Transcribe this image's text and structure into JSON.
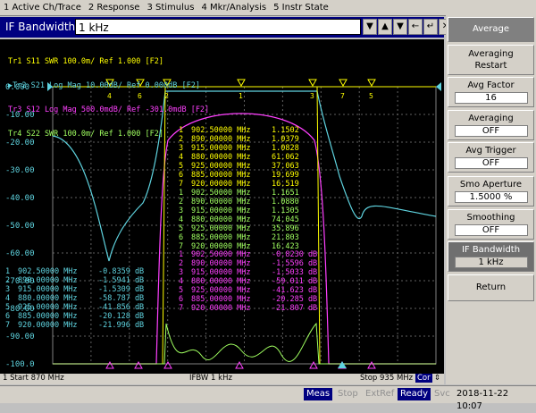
{
  "menu": [
    "1 Active Ch/Trace",
    "2 Response",
    "3 Stimulus",
    "4 Mkr/Analysis",
    "5 Instr State"
  ],
  "entry": {
    "label": "IF Bandwidth",
    "value": "1 kHz"
  },
  "traces": [
    {
      "text": "Tr1 S11 SWR 100.0m/ Ref 1.000 [F2]",
      "color": "#ffff00"
    },
    {
      "text": "▶Tr2 S21 Log Mag 10.00dB/ Ref 0.000dB [F2]",
      "color": "#5fd4e0"
    },
    {
      "text": "Tr3 S12 Log Mag 500.0mdB/ Ref -301.0mdB [F2]",
      "color": "#ff40ff"
    },
    {
      "text": "Tr4 S22 SWR 100.0m/ Ref 1.000 [F2]",
      "color": "#a0ff60"
    }
  ],
  "colors": {
    "tr1": "#ffff00",
    "tr2": "#5fd4e0",
    "tr3": "#ff40ff",
    "tr4": "#a0ff60",
    "grid": "#606060"
  },
  "y_axis": [
    "0.000",
    "-10.00",
    "-20.00",
    "-30.00",
    "-40.00",
    "-50.00",
    "-60.00",
    "-70.00",
    "-80.00",
    "-90.00",
    "-100.0"
  ],
  "markers_tr1": [
    [
      "1",
      "902.50000 MHz",
      "1.1502"
    ],
    [
      "2",
      "890.00000 MHz",
      "1.0379"
    ],
    [
      "3",
      "915.00000 MHz",
      "1.0828"
    ],
    [
      "4",
      "880.00000 MHz",
      "61.062"
    ],
    [
      "5",
      "925.00000 MHz",
      "37.063"
    ],
    [
      "6",
      "885.00000 MHz",
      "19.699"
    ],
    [
      "7",
      "920.00000 MHz",
      "16.519"
    ]
  ],
  "markers_tr4": [
    [
      "1",
      "902.50000 MHz",
      "1.1651"
    ],
    [
      "2",
      "890.00000 MHz",
      "1.0880"
    ],
    [
      "3",
      "915.00000 MHz",
      "1.1305"
    ],
    [
      "4",
      "880.00000 MHz",
      "74.045"
    ],
    [
      "5",
      "925.00000 MHz",
      "35.896"
    ],
    [
      "6",
      "885.00000 MHz",
      "21.803"
    ],
    [
      "7",
      "920.00000 MHz",
      "16.423"
    ]
  ],
  "markers_tr3": [
    [
      "1",
      "902.50000 MHz",
      "-0.8230 dB"
    ],
    [
      "2",
      "890.00000 MHz",
      "-1.5596 dB"
    ],
    [
      "3",
      "915.00000 MHz",
      "-1.5033 dB"
    ],
    [
      "4",
      "880.00000 MHz",
      "-59.011 dB"
    ],
    [
      "5",
      "925.00000 MHz",
      "-41.623 dB"
    ],
    [
      "6",
      "885.00000 MHz",
      "-20.285 dB"
    ],
    [
      "7",
      "920.00000 MHz",
      "-21.807 dB"
    ]
  ],
  "markers_tr2": [
    [
      "1",
      "902.50000 MHz",
      "-0.8359 dB"
    ],
    [
      "2",
      "890.00000 MHz",
      "-1.5941 dB"
    ],
    [
      "3",
      "915.00000 MHz",
      "-1.5309 dB"
    ],
    [
      "4",
      "880.00000 MHz",
      "-58.787 dB"
    ],
    [
      "5",
      "925.00000 MHz",
      "-41.856 dB"
    ],
    [
      "6",
      "885.00000 MHz",
      "-20.128 dB"
    ],
    [
      "7",
      "920.00000 MHz",
      "-21.996 dB"
    ]
  ],
  "softkeys": {
    "title": "Average",
    "averaging_restart": "Averaging Restart",
    "avg_factor": {
      "label": "Avg Factor",
      "value": "16"
    },
    "averaging": {
      "label": "Averaging",
      "value": "OFF"
    },
    "avg_trigger": {
      "label": "Avg Trigger",
      "value": "OFF"
    },
    "smo_aperture": {
      "label": "Smo Aperture",
      "value": "1.5000 %"
    },
    "smoothing": {
      "label": "Smoothing",
      "value": "OFF"
    },
    "if_bandwidth": {
      "label": "IF Bandwidth",
      "value": "1 kHz"
    },
    "return": "Return"
  },
  "status": {
    "start": "1  Start 870 MHz",
    "ifbw": "IFBW 1 kHz",
    "stop": "Stop 935 MHz",
    "cor": "Cor"
  },
  "bottom": {
    "meas": "Meas",
    "stop": "Stop",
    "extref": "ExtRef",
    "ready": "Ready",
    "svc": "Svc",
    "datetime": "2018-11-22 10:07"
  }
}
